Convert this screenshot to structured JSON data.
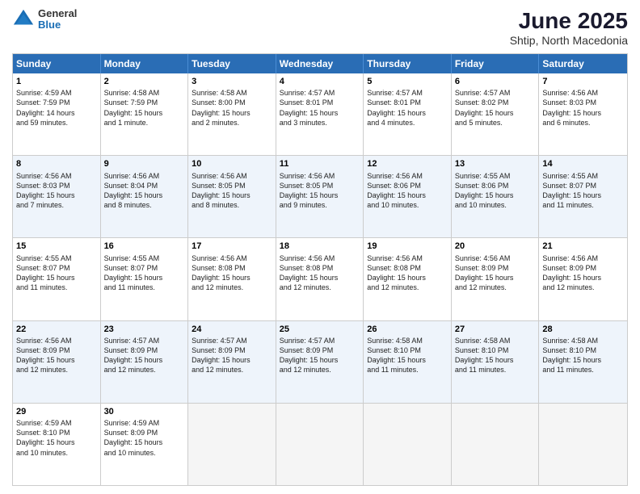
{
  "logo": {
    "general": "General",
    "blue": "Blue"
  },
  "title": "June 2025",
  "subtitle": "Shtip, North Macedonia",
  "days": [
    "Sunday",
    "Monday",
    "Tuesday",
    "Wednesday",
    "Thursday",
    "Friday",
    "Saturday"
  ],
  "rows": [
    [
      {
        "day": "1",
        "info": "Sunrise: 4:59 AM\nSunset: 7:59 PM\nDaylight: 14 hours\nand 59 minutes."
      },
      {
        "day": "2",
        "info": "Sunrise: 4:58 AM\nSunset: 7:59 PM\nDaylight: 15 hours\nand 1 minute."
      },
      {
        "day": "3",
        "info": "Sunrise: 4:58 AM\nSunset: 8:00 PM\nDaylight: 15 hours\nand 2 minutes."
      },
      {
        "day": "4",
        "info": "Sunrise: 4:57 AM\nSunset: 8:01 PM\nDaylight: 15 hours\nand 3 minutes."
      },
      {
        "day": "5",
        "info": "Sunrise: 4:57 AM\nSunset: 8:01 PM\nDaylight: 15 hours\nand 4 minutes."
      },
      {
        "day": "6",
        "info": "Sunrise: 4:57 AM\nSunset: 8:02 PM\nDaylight: 15 hours\nand 5 minutes."
      },
      {
        "day": "7",
        "info": "Sunrise: 4:56 AM\nSunset: 8:03 PM\nDaylight: 15 hours\nand 6 minutes."
      }
    ],
    [
      {
        "day": "8",
        "info": "Sunrise: 4:56 AM\nSunset: 8:03 PM\nDaylight: 15 hours\nand 7 minutes."
      },
      {
        "day": "9",
        "info": "Sunrise: 4:56 AM\nSunset: 8:04 PM\nDaylight: 15 hours\nand 8 minutes."
      },
      {
        "day": "10",
        "info": "Sunrise: 4:56 AM\nSunset: 8:05 PM\nDaylight: 15 hours\nand 8 minutes."
      },
      {
        "day": "11",
        "info": "Sunrise: 4:56 AM\nSunset: 8:05 PM\nDaylight: 15 hours\nand 9 minutes."
      },
      {
        "day": "12",
        "info": "Sunrise: 4:56 AM\nSunset: 8:06 PM\nDaylight: 15 hours\nand 10 minutes."
      },
      {
        "day": "13",
        "info": "Sunrise: 4:55 AM\nSunset: 8:06 PM\nDaylight: 15 hours\nand 10 minutes."
      },
      {
        "day": "14",
        "info": "Sunrise: 4:55 AM\nSunset: 8:07 PM\nDaylight: 15 hours\nand 11 minutes."
      }
    ],
    [
      {
        "day": "15",
        "info": "Sunrise: 4:55 AM\nSunset: 8:07 PM\nDaylight: 15 hours\nand 11 minutes."
      },
      {
        "day": "16",
        "info": "Sunrise: 4:55 AM\nSunset: 8:07 PM\nDaylight: 15 hours\nand 11 minutes."
      },
      {
        "day": "17",
        "info": "Sunrise: 4:56 AM\nSunset: 8:08 PM\nDaylight: 15 hours\nand 12 minutes."
      },
      {
        "day": "18",
        "info": "Sunrise: 4:56 AM\nSunset: 8:08 PM\nDaylight: 15 hours\nand 12 minutes."
      },
      {
        "day": "19",
        "info": "Sunrise: 4:56 AM\nSunset: 8:08 PM\nDaylight: 15 hours\nand 12 minutes."
      },
      {
        "day": "20",
        "info": "Sunrise: 4:56 AM\nSunset: 8:09 PM\nDaylight: 15 hours\nand 12 minutes."
      },
      {
        "day": "21",
        "info": "Sunrise: 4:56 AM\nSunset: 8:09 PM\nDaylight: 15 hours\nand 12 minutes."
      }
    ],
    [
      {
        "day": "22",
        "info": "Sunrise: 4:56 AM\nSunset: 8:09 PM\nDaylight: 15 hours\nand 12 minutes."
      },
      {
        "day": "23",
        "info": "Sunrise: 4:57 AM\nSunset: 8:09 PM\nDaylight: 15 hours\nand 12 minutes."
      },
      {
        "day": "24",
        "info": "Sunrise: 4:57 AM\nSunset: 8:09 PM\nDaylight: 15 hours\nand 12 minutes."
      },
      {
        "day": "25",
        "info": "Sunrise: 4:57 AM\nSunset: 8:09 PM\nDaylight: 15 hours\nand 12 minutes."
      },
      {
        "day": "26",
        "info": "Sunrise: 4:58 AM\nSunset: 8:10 PM\nDaylight: 15 hours\nand 11 minutes."
      },
      {
        "day": "27",
        "info": "Sunrise: 4:58 AM\nSunset: 8:10 PM\nDaylight: 15 hours\nand 11 minutes."
      },
      {
        "day": "28",
        "info": "Sunrise: 4:58 AM\nSunset: 8:10 PM\nDaylight: 15 hours\nand 11 minutes."
      }
    ],
    [
      {
        "day": "29",
        "info": "Sunrise: 4:59 AM\nSunset: 8:10 PM\nDaylight: 15 hours\nand 10 minutes."
      },
      {
        "day": "30",
        "info": "Sunrise: 4:59 AM\nSunset: 8:09 PM\nDaylight: 15 hours\nand 10 minutes."
      },
      {
        "day": "",
        "info": ""
      },
      {
        "day": "",
        "info": ""
      },
      {
        "day": "",
        "info": ""
      },
      {
        "day": "",
        "info": ""
      },
      {
        "day": "",
        "info": ""
      }
    ]
  ]
}
